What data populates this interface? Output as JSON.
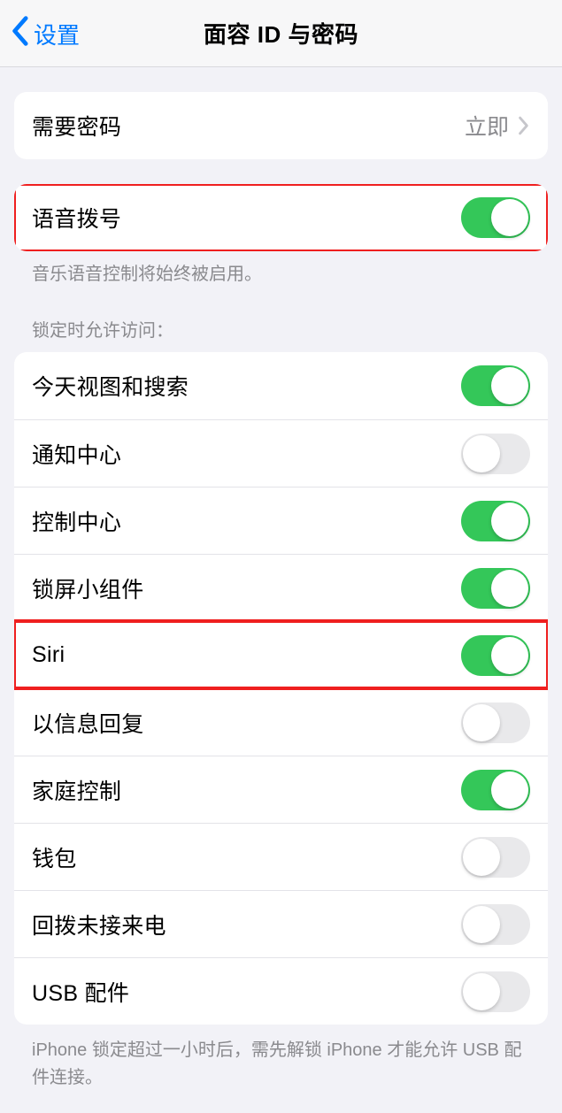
{
  "nav": {
    "back_label": "设置",
    "title": "面容 ID 与密码"
  },
  "passcode": {
    "label": "需要密码",
    "value": "立即"
  },
  "voice_dial": {
    "label": "语音拨号",
    "on": true,
    "footer": "音乐语音控制将始终被启用。"
  },
  "lock_access": {
    "header": "锁定时允许访问：",
    "items": [
      {
        "label": "今天视图和搜索",
        "on": true
      },
      {
        "label": "通知中心",
        "on": false
      },
      {
        "label": "控制中心",
        "on": true
      },
      {
        "label": "锁屏小组件",
        "on": true
      },
      {
        "label": "Siri",
        "on": true
      },
      {
        "label": "以信息回复",
        "on": false
      },
      {
        "label": "家庭控制",
        "on": true
      },
      {
        "label": "钱包",
        "on": false
      },
      {
        "label": "回拨未接来电",
        "on": false
      },
      {
        "label": "USB 配件",
        "on": false
      }
    ],
    "footer": "iPhone 锁定超过一小时后，需先解锁 iPhone 才能允许 USB 配件连接。"
  },
  "highlight_indices": {
    "voice_dial": true,
    "siri_index": 4
  }
}
